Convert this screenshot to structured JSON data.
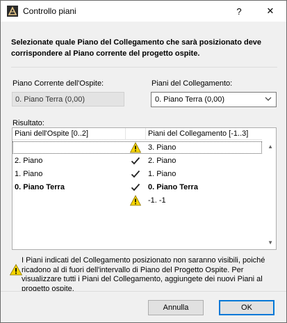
{
  "window": {
    "title": "Controllo piani",
    "help_label": "?",
    "close_label": "✕"
  },
  "instruction": "Selezionate quale Piano del Collegamento che sarà posizionato deve corrispondere al Piano corrente del progetto ospite.",
  "current_host": {
    "label": "Piano Corrente dell'Ospite:",
    "value": "0. Piano Terra (0,00)"
  },
  "linked": {
    "label": "Piani del Collegamento:",
    "selected": "0. Piano Terra (0,00)"
  },
  "result": {
    "label": "Risultato:",
    "col_host": "Piani dell'Ospite [0..2]",
    "col_link": "Piani del Collegamento [-1..3]",
    "rows": [
      {
        "host": "",
        "status": "warning",
        "link": "3. Piano"
      },
      {
        "host": "2. Piano",
        "status": "check",
        "link": "2. Piano"
      },
      {
        "host": "1. Piano",
        "status": "check",
        "link": "1. Piano"
      },
      {
        "host": "0. Piano Terra",
        "status": "check",
        "link": "0. Piano Terra"
      },
      {
        "host": "",
        "status": "warning",
        "link": "-1. -1"
      }
    ]
  },
  "warning_text": "I Piani indicati del Collegamento posizionato non saranno visibili, poiché ricadono al di fuori dell'intervallo di Piano del Progetto Ospite. Per visualizzare tutti i Piani del Collegamento, aggiungete dei nuovi Piani al progetto ospite.",
  "buttons": {
    "cancel": "Annulla",
    "ok": "OK"
  },
  "colors": {
    "warning": "#f5d400",
    "accent": "#0078d7"
  }
}
